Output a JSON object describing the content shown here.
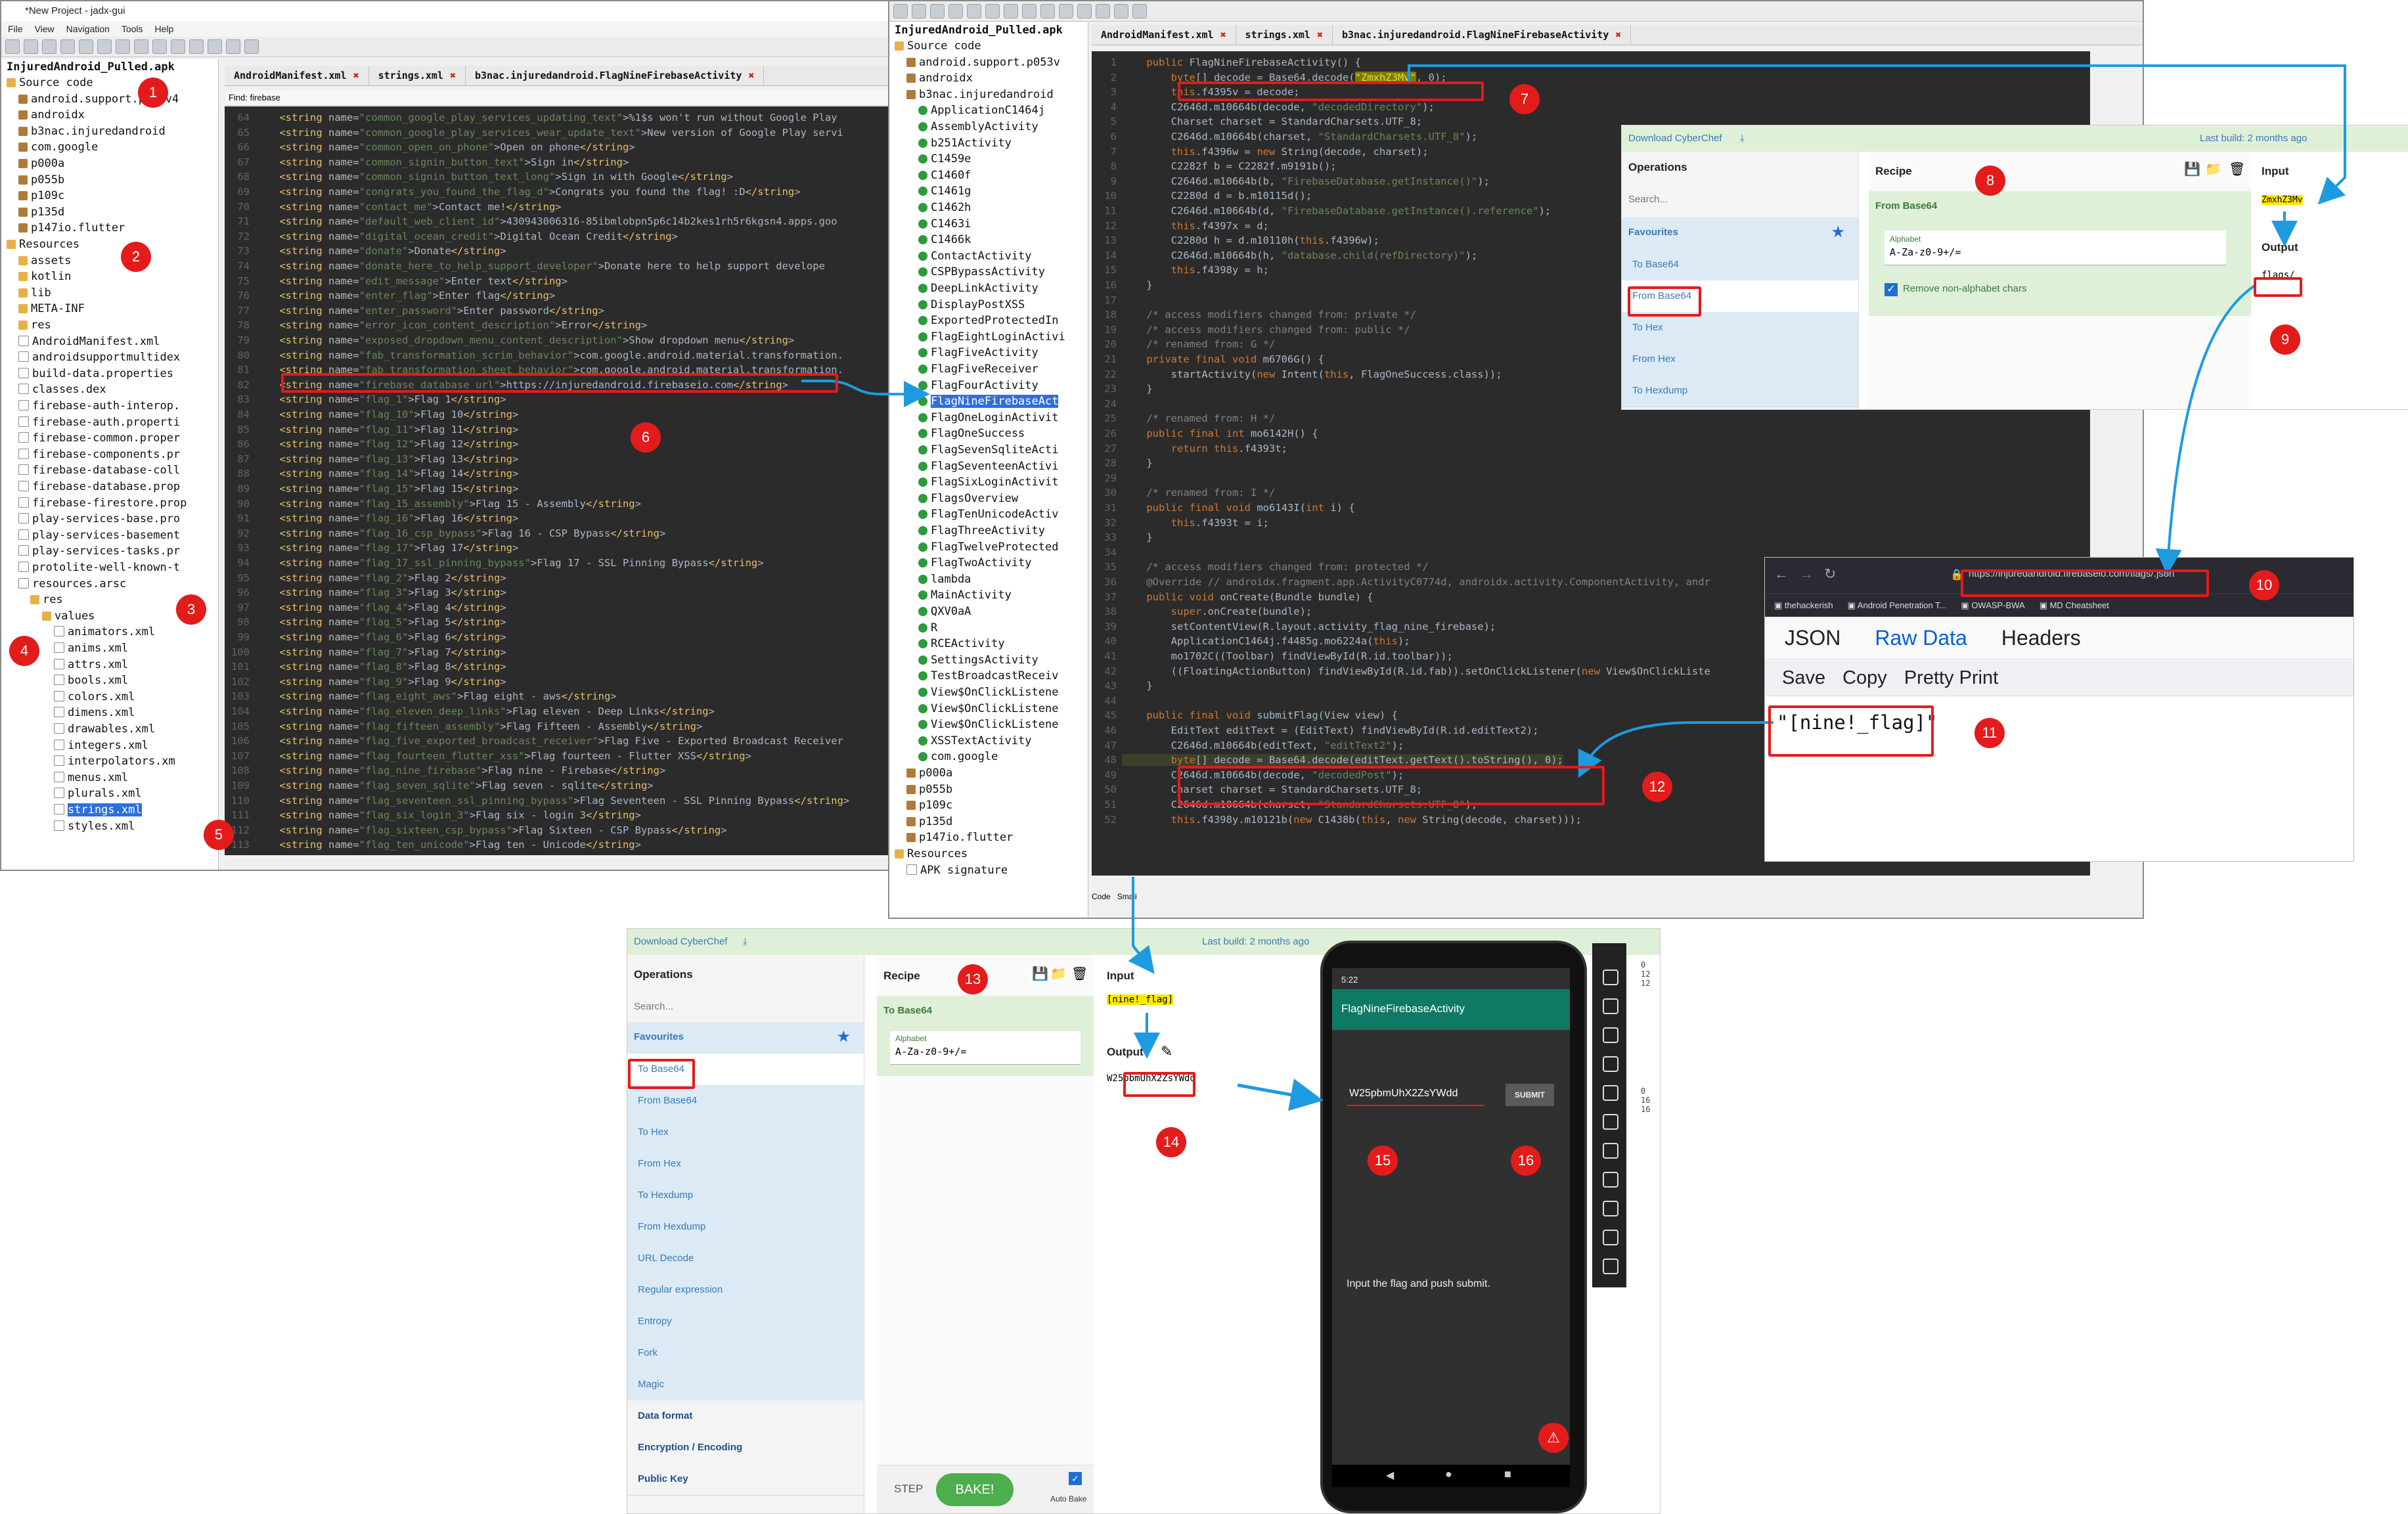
{
  "jadx1": {
    "title": "*New Project - jadx-gui",
    "menu": [
      "File",
      "View",
      "Navigation",
      "Tools",
      "Help"
    ],
    "root": "InjuredAndroid_Pulled.apk",
    "tree": [
      "Source code",
      "android.support.p053v4",
      "androidx",
      "b3nac.injuredandroid",
      "com.google",
      "p000a",
      "p055b",
      "p109c",
      "p135d",
      "p147io.flutter",
      "Resources",
      "assets",
      "kotlin",
      "lib",
      "META-INF",
      "res",
      "AndroidManifest.xml",
      "androidsupportmultidex",
      "build-data.properties",
      "classes.dex",
      "firebase-auth-interop.",
      "firebase-auth.properti",
      "firebase-common.proper",
      "firebase-components.pr",
      "firebase-database-coll",
      "firebase-database.prop",
      "firebase-firestore.prop",
      "play-services-base.pro",
      "play-services-basement",
      "play-services-tasks.pr",
      "protolite-well-known-t",
      "resources.arsc",
      "res",
      "values",
      "animators.xml",
      "anims.xml",
      "attrs.xml",
      "bools.xml",
      "colors.xml",
      "dimens.xml",
      "drawables.xml",
      "integers.xml",
      "interpolators.xm",
      "menus.xml",
      "plurals.xml",
      "strings.xml",
      "styles.xml"
    ],
    "tabs": [
      "AndroidManifest.xml",
      "strings.xml",
      "b3nac.injuredandroid.FlagNineFirebaseActivity"
    ],
    "find_label": "Find: firebase",
    "highlight_line_no": "82",
    "code_lines": [
      "    <string name=\"common_google_play_services_updating_text\">%1$s won't run without Google Play",
      "    <string name=\"common_google_play_services_wear_update_text\">New version of Google Play servi",
      "    <string name=\"common_open_on_phone\">Open on phone</string>",
      "    <string name=\"common_signin_button_text\">Sign in</string>",
      "    <string name=\"common_signin_button_text_long\">Sign in with Google</string>",
      "    <string name=\"congrats_you_found_the_flag_d\">Congrats you found the flag! :D</string>",
      "    <string name=\"contact_me\">Contact me!</string>",
      "    <string name=\"default_web_client_id\">430943006316-85ibmlobpn5p6c14b2kes1rh5r6kgsn4.apps.goo",
      "    <string name=\"digital_ocean_credit\">Digital Ocean Credit</string>",
      "    <string name=\"donate\">Donate</string>",
      "    <string name=\"donate_here_to_help_support_developer\">Donate here to help support develope",
      "    <string name=\"edit_message\">Enter text</string>",
      "    <string name=\"enter_flag\">Enter flag</string>",
      "    <string name=\"enter_password\">Enter password</string>",
      "    <string name=\"error_icon_content_description\">Error</string>",
      "    <string name=\"exposed_dropdown_menu_content_description\">Show dropdown menu</string>",
      "    <string name=\"fab_transformation_scrim_behavior\">com.google.android.material.transformation.",
      "    <string name=\"fab_transformation_sheet_behavior\">com.google.android.material.transformation.",
      "    <string name=\"firebase_database_url\">https://injuredandroid.firebaseio.com</string>",
      "    <string name=\"flag_1\">Flag 1</string>",
      "    <string name=\"flag_10\">Flag 10</string>",
      "    <string name=\"flag_11\">Flag 11</string>",
      "    <string name=\"flag_12\">Flag 12</string>",
      "    <string name=\"flag_13\">Flag 13</string>",
      "    <string name=\"flag_14\">Flag 14</string>",
      "    <string name=\"flag_15\">Flag 15</string>",
      "    <string name=\"flag_15_assembly\">Flag 15 - Assembly</string>",
      "    <string name=\"flag_16\">Flag 16</string>",
      "    <string name=\"flag_16_csp_bypass\">Flag 16 - CSP Bypass</string>",
      "    <string name=\"flag_17\">Flag 17</string>",
      "    <string name=\"flag_17_ssl_pinning_bypass\">Flag 17 - SSL Pinning Bypass</string>",
      "    <string name=\"flag_2\">Flag 2</string>",
      "    <string name=\"flag_3\">Flag 3</string>",
      "    <string name=\"flag_4\">Flag 4</string>",
      "    <string name=\"flag_5\">Flag 5</string>",
      "    <string name=\"flag_6\">Flag 6</string>",
      "    <string name=\"flag_7\">Flag 7</string>",
      "    <string name=\"flag_8\">Flag 8</string>",
      "    <string name=\"flag_9\">Flag 9</string>",
      "    <string name=\"flag_eight_aws\">Flag eight - aws</string>",
      "    <string name=\"flag_eleven_deep_links\">Flag eleven - Deep Links</string>",
      "    <string name=\"flag_fifteen_assembly\">Flag Fifteen - Assembly</string>",
      "    <string name=\"flag_five_exported_broadcast_receiver\">Flag Five - Exported Broadcast Receiver",
      "    <string name=\"flag_fourteen_flutter_xss\">Flag fourteen - Flutter XSS</string>",
      "    <string name=\"flag_nine_firebase\">Flag nine - Firebase</string>",
      "    <string name=\"flag_seven_sqlite\">Flag seven - sqlite</string>",
      "    <string name=\"flag_seventeen_ssl_pinning_bypass\">Flag Seventeen - SSL Pinning Bypass</string>",
      "    <string name=\"flag_six_login_3\">Flag six - login 3</string>",
      "    <string name=\"flag_sixteen_csp_bypass\">Flag Sixteen - CSP Bypass</string>",
      "    <string name=\"flag_ten_unicode\">Flag ten - Unicode</string>"
    ]
  },
  "jadx2": {
    "root": "InjuredAndroid_Pulled.apk",
    "tree": [
      "Source code",
      "android.support.p053v",
      "androidx",
      "b3nac.injuredandroid",
      "ApplicationC1464j",
      "AssemblyActivity",
      "b251Activity",
      "C1459e",
      "C1460f",
      "C1461g",
      "C1462h",
      "C1463i",
      "C1466k",
      "ContactActivity",
      "CSPBypassActivity",
      "DeepLinkActivity",
      "DisplayPostXSS",
      "ExportedProtectedIn",
      "FlagEightLoginActivi",
      "FlagFiveActivity",
      "FlagFiveReceiver",
      "FlagFourActivity",
      "FlagNineFirebaseAct",
      "FlagOneLoginActivit",
      "FlagOneSuccess",
      "FlagSevenSqliteActi",
      "FlagSeventeenActivi",
      "FlagSixLoginActivit",
      "FlagsOverview",
      "FlagTenUnicodeActiv",
      "FlagThreeActivity",
      "FlagTwelveProtected",
      "FlagTwoActivity",
      "lambda",
      "MainActivity",
      "QXV0aA",
      "R",
      "RCEActivity",
      "SettingsActivity",
      "TestBroadcastReceiv",
      "View$OnClickListene",
      "View$OnClickListene",
      "View$OnClickListene",
      "XSSTextActivity",
      "com.google",
      "p000a",
      "p055b",
      "p109c",
      "p135d",
      "p147io.flutter",
      "Resources",
      "APK signature"
    ],
    "tabs": [
      "AndroidManifest.xml",
      "strings.xml",
      "b3nac.injuredandroid.FlagNineFirebaseActivity"
    ],
    "bottom_tabs": [
      "Code",
      "Smali"
    ],
    "code_lines": [
      "    public FlagNineFirebaseActivity() {",
      "        byte[] decode = Base64.decode(\"ZmxhZ3Mv\", 0);",
      "        this.f4395v = decode;",
      "        C2646d.m10664b(decode, \"decodedDirectory\");",
      "        Charset charset = StandardCharsets.UTF_8;",
      "        C2646d.m10664b(charset, \"StandardCharsets.UTF_8\");",
      "        this.f4396w = new String(decode, charset);",
      "        C2282f b = C2282f.m9191b();",
      "        C2646d.m10664b(b, \"FirebaseDatabase.getInstance()\");",
      "        C2280d d = b.m10115d();",
      "        C2646d.m10664b(d, \"FirebaseDatabase.getInstance().reference\");",
      "        this.f4397x = d;",
      "        C2280d h = d.m10110h(this.f4396w);",
      "        C2646d.m10664b(h, \"database.child(refDirectory)\");",
      "        this.f4398y = h;",
      "    }",
      "",
      "    /* access modifiers changed from: private */",
      "    /* access modifiers changed from: public */",
      "    /* renamed from: G */",
      "    private final void m6706G() {",
      "        startActivity(new Intent(this, FlagOneSuccess.class));",
      "    }",
      "",
      "    /* renamed from: H */",
      "    public final int mo6142H() {",
      "        return this.f4393t;",
      "    }",
      "",
      "    /* renamed from: I */",
      "    public final void mo6143I(int i) {",
      "        this.f4393t = i;",
      "    }",
      "",
      "    /* access modifiers changed from: protected */",
      "    @Override // androidx.fragment.app.ActivityC0774d, androidx.activity.ComponentActivity, andr",
      "    public void onCreate(Bundle bundle) {",
      "        super.onCreate(bundle);",
      "        setContentView(R.layout.activity_flag_nine_firebase);",
      "        ApplicationC1464j.f4485g.mo6224a(this);",
      "        mo1702C((Toolbar) findViewById(R.id.toolbar));",
      "        ((FloatingActionButton) findViewById(R.id.fab)).setOnClickListener(new View$OnClickListe",
      "    }",
      "",
      "    public final void submitFlag(View view) {",
      "        EditText editText = (EditText) findViewById(R.id.editText2);",
      "        C2646d.m10664b(editText, \"editText2\");",
      "        byte[] decode = Base64.decode(editText.getText().toString(), 0);",
      "        C2646d.m10664b(decode, \"decodedPost\");",
      "        Charset charset = StandardCharsets.UTF_8;",
      "        C2646d.m10664b(charset, \"StandardCharsets.UTF_8\");",
      "        this.f4398y.m10121b(new C1438b(this, new String(decode, charset)));"
    ]
  },
  "cyberchef1": {
    "download": "Download CyberChef",
    "last_build": "Last build: 2 months ago",
    "operations_title": "Operations",
    "search_placeholder": "Search...",
    "favourites": "Favourites",
    "ops": [
      "To Base64",
      "From Base64",
      "To Hex",
      "From Hex",
      "To Hexdump"
    ],
    "recipe_title": "Recipe",
    "recipe_op": "From Base64",
    "alphabet_label": "Alphabet",
    "alphabet_value": "A-Za-z0-9+/=",
    "remove_label": "Remove non-alphabet chars",
    "input_title": "Input",
    "input_value": "ZmxhZ3Mv",
    "output_title": "Output",
    "output_value": "flags/"
  },
  "browser": {
    "url": "https://injuredandroid.firebaseio.com/flags/.json",
    "bookmarks": [
      "thehackerish",
      "Android Penetration T...",
      "OWASP-BWA",
      "MD Cheatsheet"
    ],
    "tabs": [
      "JSON",
      "Raw Data",
      "Headers"
    ],
    "actions": [
      "Save",
      "Copy",
      "Pretty Print"
    ],
    "result": "\"[nine!_flag]\""
  },
  "cyberchef2": {
    "download": "Download CyberChef",
    "last_build": "Last build: 2 months ago",
    "operations_title": "Operations",
    "search_placeholder": "Search...",
    "favourites": "Favourites",
    "ops": [
      "To Base64",
      "From Base64",
      "To Hex",
      "From Hex",
      "To Hexdump",
      "From Hexdump",
      "URL Decode",
      "Regular expression",
      "Entropy",
      "Fork",
      "Magic"
    ],
    "categories": [
      "Data format",
      "Encryption / Encoding",
      "Public Key"
    ],
    "recipe_title": "Recipe",
    "recipe_op": "To Base64",
    "alphabet_label": "Alphabet",
    "alphabet_value": "A-Za-z0-9+/=",
    "input_title": "Input",
    "input_value": "[nine!_flag]",
    "output_title": "Output",
    "output_value": "W25pbmUhX2ZsYWdd",
    "step": "STEP",
    "bake": "BAKE!",
    "autobake": "Auto Bake"
  },
  "phone": {
    "time": "5:22",
    "app_title": "FlagNineFirebaseActivity",
    "edit_value": "W25pbmUhX2ZsYWdd",
    "submit": "SUBMIT",
    "hint": "Input the flag and push submit."
  },
  "emulator_side": [
    "0",
    "12",
    "12",
    "0",
    "16",
    "16"
  ],
  "badges": [
    "1",
    "2",
    "3",
    "4",
    "5",
    "6",
    "7",
    "8",
    "9",
    "10",
    "11",
    "12",
    "13",
    "14",
    "15",
    "16"
  ],
  "colors": {
    "annotation": "#e41b1b",
    "arrow": "#1e9be0",
    "code_bg": "#2b2b2b",
    "cyberchef_green": "#dff0d8"
  }
}
